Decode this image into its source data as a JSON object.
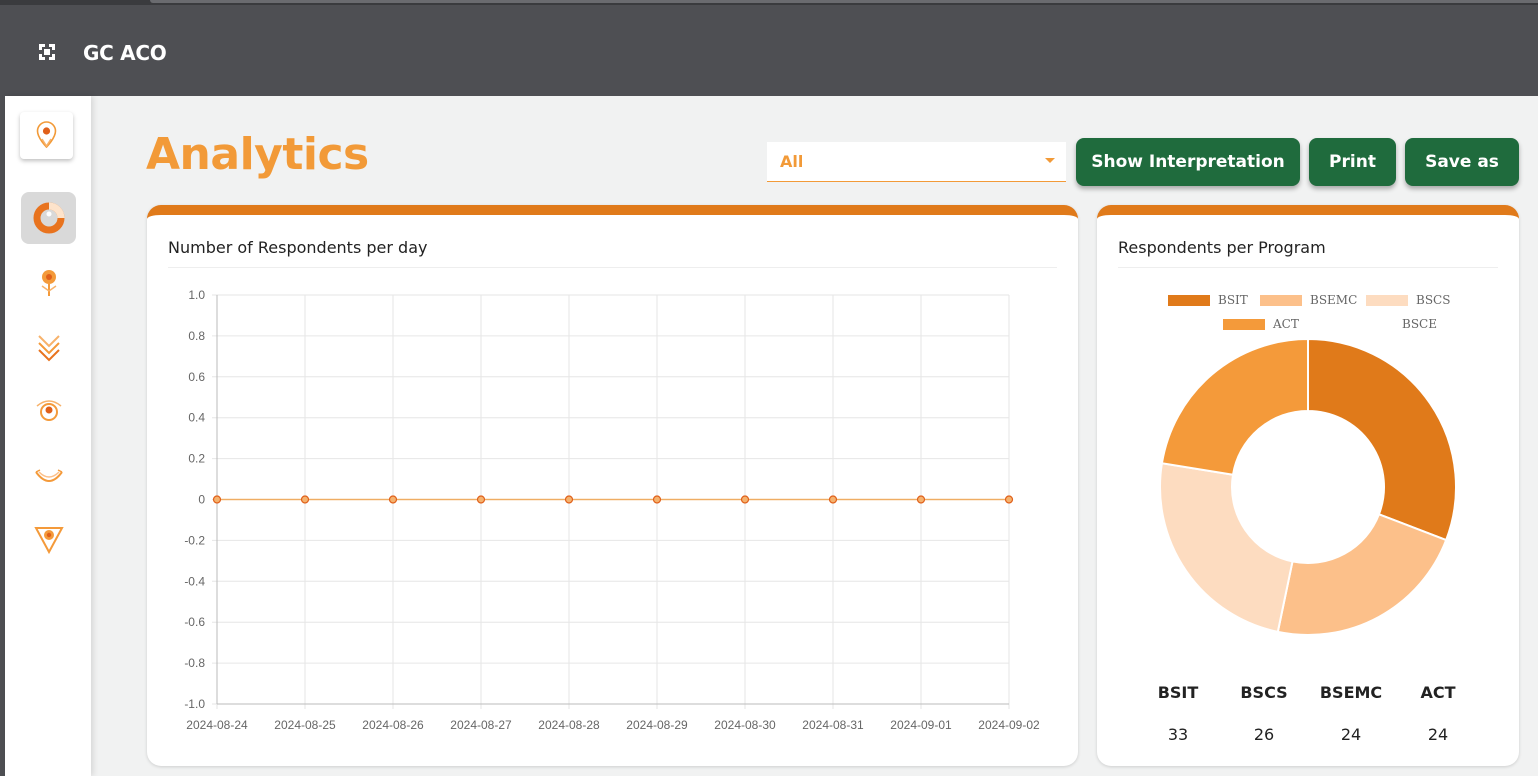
{
  "app": {
    "title": "GC ACO"
  },
  "page": {
    "title": "Analytics"
  },
  "filter": {
    "selected": "All"
  },
  "toolbar": {
    "interpretation_label": "Show Interpretation",
    "print_label": "Print",
    "save_label": "Save as"
  },
  "sidebar": {
    "items": [
      {
        "icon": "donut-chart-icon",
        "active": true
      },
      {
        "icon": "pin-icon",
        "active": false
      },
      {
        "icon": "chevrons-down-icon",
        "active": false
      },
      {
        "icon": "eye-badge-icon",
        "active": false
      },
      {
        "icon": "smile-curve-icon",
        "active": false
      },
      {
        "icon": "shield-badge-icon",
        "active": false
      }
    ]
  },
  "colors": {
    "accent": "#f29a38",
    "header": "#4e4f53",
    "button": "#1f6b3d",
    "card_top": "#e07a1a"
  },
  "line_card": {
    "title": "Number of Respondents per day"
  },
  "pie_card": {
    "title": "Respondents per Program"
  },
  "summary": [
    {
      "label": "BSIT",
      "value": "33"
    },
    {
      "label": "BSCS",
      "value": "26"
    },
    {
      "label": "BSEMC",
      "value": "24"
    },
    {
      "label": "ACT",
      "value": "24"
    }
  ],
  "chart_data": [
    {
      "type": "line",
      "title": "Number of Respondents per day",
      "x": [
        "2024-08-24",
        "2024-08-25",
        "2024-08-26",
        "2024-08-27",
        "2024-08-28",
        "2024-08-29",
        "2024-08-30",
        "2024-08-31",
        "2024-09-01",
        "2024-09-02"
      ],
      "series": [
        {
          "values": [
            0,
            0,
            0,
            0,
            0,
            0,
            0,
            0,
            0,
            0
          ],
          "color": "#f29a38"
        }
      ],
      "ylim": [
        -1.0,
        1.0
      ],
      "yticks": [
        "1.0",
        "0.8",
        "0.6",
        "0.4",
        "0.2",
        "0",
        "-0.2",
        "-0.4",
        "-0.6",
        "-0.8",
        "-1.0"
      ],
      "grid": true
    },
    {
      "type": "pie",
      "title": "Respondents per Program",
      "categories": [
        "BSIT",
        "BSEMC",
        "BSCS",
        "ACT",
        "BSCE"
      ],
      "values": [
        33,
        24,
        26,
        24,
        0
      ],
      "colors": [
        "#e07a1a",
        "#fcc08a",
        "#fddcc0",
        "#f49a3a",
        "#ffffff"
      ],
      "legend": "top"
    }
  ]
}
